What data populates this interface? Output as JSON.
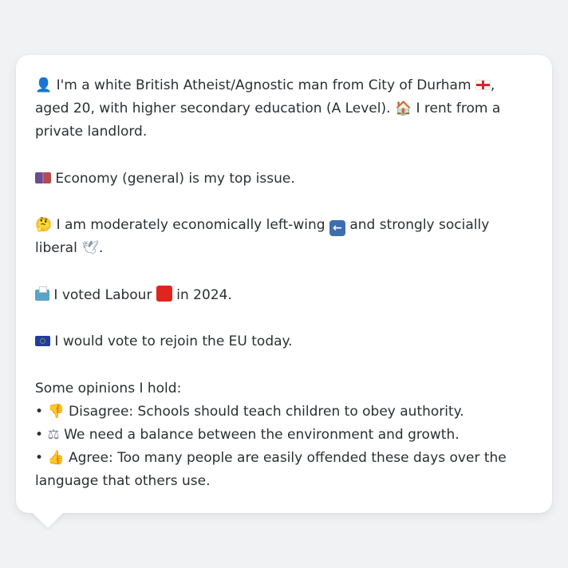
{
  "profile": {
    "identity_text": "I'm a white British Atheist/Agnostic man from City of Durham",
    "identity_text_2": ", aged 20, with higher secondary education (A Level).",
    "housing_text": "I rent from a private landlord.",
    "top_issue_text": "Economy (general) is my top issue.",
    "ideology_text_1": "I am moderately economically left-wing",
    "ideology_text_2": "and strongly socially liberal",
    "ideology_text_3": ".",
    "vote_text_1": "I voted Labour",
    "vote_text_2": "in 2024.",
    "eu_text": "I would vote to rejoin the EU today.",
    "opinions_heading": "Some opinions I hold:",
    "bullet": "•",
    "opinions": [
      {
        "icon": "thumbs-down-icon",
        "text": "Disagree: Schools should teach children to obey authority."
      },
      {
        "icon": "scales-icon",
        "text": "We need a balance between the environment and growth."
      },
      {
        "icon": "thumbs-up-icon",
        "text": "Agree: Too many people are easily offended these days over the language that others use."
      }
    ]
  },
  "colors": {
    "background": "#f1f2f4",
    "card": "#ffffff",
    "text": "#2b2f33",
    "labour_red": "#e02521",
    "eu_blue": "#1f3f9c"
  }
}
